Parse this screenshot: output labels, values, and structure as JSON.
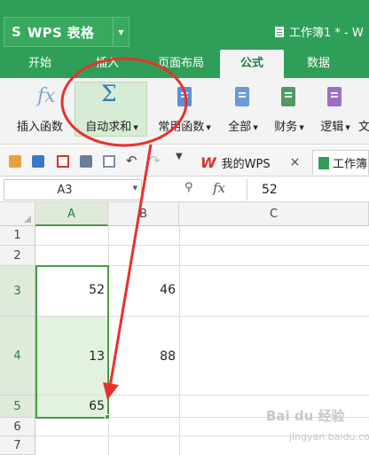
{
  "app": {
    "logo": "S",
    "name": "WPS 表格",
    "document_title": "工作簿1 * - W"
  },
  "tabs": [
    "开始",
    "插入",
    "页面布局",
    "公式",
    "数据"
  ],
  "active_tab": "公式",
  "ribbon": {
    "insert_function": "插入函数",
    "autosum": "自动求和",
    "common_functions": "常用函数",
    "all": "全部",
    "finance": "财务",
    "logic": "逻辑",
    "text_partial": "文"
  },
  "toolbar": {
    "doc_tab_1": "我的WPS",
    "doc_tab_2": "工作簿",
    "close_glyph": "×"
  },
  "formula_bar": {
    "name_box": "A3",
    "fx_label": "fx",
    "value": "52"
  },
  "grid": {
    "columns": [
      "A",
      "B",
      "C"
    ],
    "rows": [
      "1",
      "2",
      "3",
      "4",
      "5",
      "6",
      "7"
    ],
    "cells": {
      "A3": "52",
      "B3": "46",
      "A4": "13",
      "B4": "88",
      "A5": "65"
    }
  },
  "watermark": {
    "brand": "Bai du 经验",
    "url": "jingyan.baidu.com"
  },
  "colors": {
    "accent": "#2f9e58",
    "annotation": "#e8322c",
    "selection": "#4a9a48"
  }
}
